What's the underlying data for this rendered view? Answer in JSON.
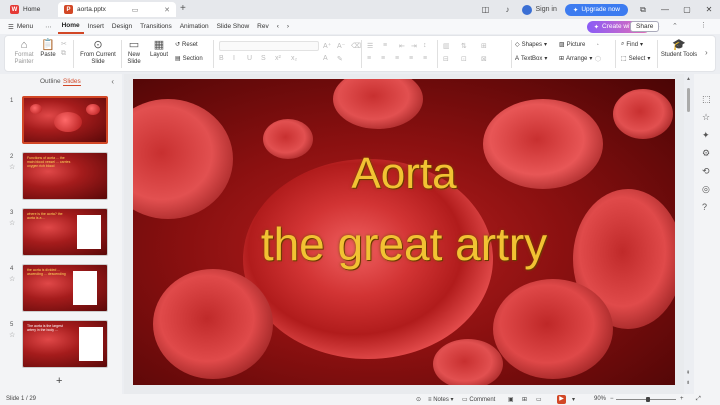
{
  "titlebar": {
    "home_tab": "Home",
    "doc_tab": "aorta.pptx",
    "signin": "Sign in",
    "upgrade": "Upgrade now"
  },
  "menu": {
    "menu_label": "Menu",
    "tabs": [
      "Home",
      "Insert",
      "Design",
      "Transitions",
      "Animation",
      "Slide Show",
      "Rev"
    ],
    "create_ai": "Create with AI",
    "share": "Share"
  },
  "ribbon": {
    "format_painter": "Format Painter",
    "paste": "Paste",
    "from_current_slide": "From Current Slide",
    "new_slide": "New Slide",
    "layout": "Layout",
    "reset": "Reset",
    "section": "Section",
    "shapes": "Shapes",
    "picture": "Picture",
    "textbox": "TextBox",
    "arrange": "Arrange",
    "find": "Find",
    "select": "Select",
    "student_tools": "Student Tools"
  },
  "leftpanel": {
    "tab_outline": "Outline",
    "tab_slides": "Slides",
    "thumbs": [
      {
        "num": "1",
        "text": ""
      },
      {
        "num": "2",
        "text": "Functions of aorta ... the main blood vessel ... carries oxygen rich blood"
      },
      {
        "num": "3",
        "text": "where is the aorta? the aorta is a ..."
      },
      {
        "num": "4",
        "text": "the aorta is divided ... ascending ... descending"
      },
      {
        "num": "5",
        "text": "The aorta is the largest artery in the body ..."
      }
    ]
  },
  "slide": {
    "title_line1": "Aorta",
    "title_line2": "the great artry"
  },
  "status": {
    "slide_indicator": "Slide 1 / 29",
    "notes": "Notes",
    "comment": "Comment",
    "zoom": "90%"
  },
  "colors": {
    "accent": "#d24726",
    "upgrade": "#3c7bf0",
    "title_text": "#f2c233"
  }
}
